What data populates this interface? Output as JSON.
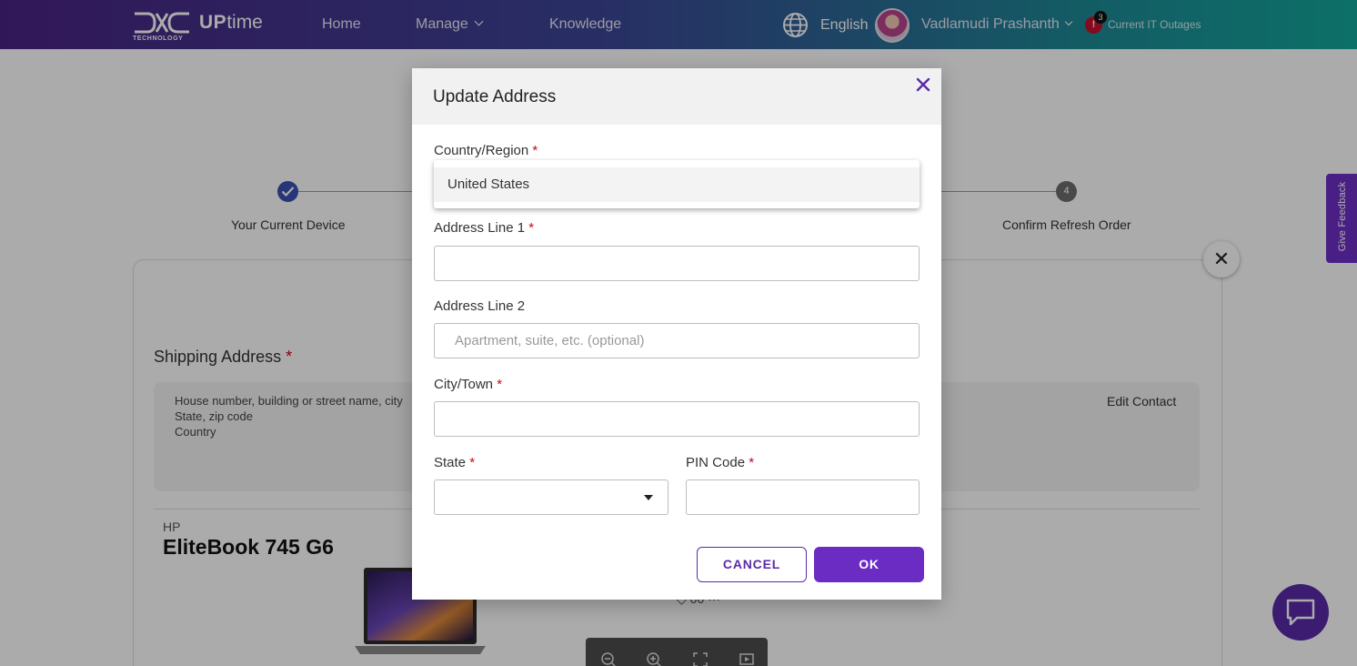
{
  "header": {
    "logo_sub": "TECHNOLOGY",
    "brand_up": "UP",
    "brand_time": "time",
    "nav": {
      "home": "Home",
      "manage": "Manage",
      "knowledge": "Knowledge"
    },
    "language": "English",
    "user_name": "Vadlamudi Prashanth",
    "alert_symbol": "!",
    "alert_count": "3",
    "outages_label": "Current IT Outages"
  },
  "steps": {
    "step1_label": "Your Current Device",
    "step4_number": "4",
    "step4_label": "Confirm Refresh Order"
  },
  "shipping": {
    "title": "Shipping Address",
    "required_mark": "*",
    "address_lines": [
      "House number, building or street name, city",
      "State, zip code",
      "Country"
    ],
    "edit_contact": "Edit Contact"
  },
  "device": {
    "brand": "HP",
    "model": "EliteBook 745 G6",
    "storage_partial": "◇ 00 ···"
  },
  "side": {
    "feedback_label": "Give Feedback",
    "close_symbol": "✕"
  },
  "modal": {
    "title": "Update Address",
    "country_label": "Country/Region",
    "country_option": "United States",
    "address1_label": "Address Line 1",
    "address1_value": "",
    "address2_label": "Address Line 2",
    "address2_placeholder": "Apartment, suite, etc. (optional)",
    "city_label": "City/Town",
    "city_value": "",
    "state_label": "State",
    "state_value": "",
    "pin_label": "PIN Code",
    "pin_value": "",
    "required_mark": "*",
    "cancel_label": "CANCEL",
    "ok_label": "OK"
  },
  "icons": {
    "globe": "globe-icon",
    "chat": "chat-icon",
    "zoom_out": "zoom-out-icon",
    "zoom_in": "zoom-in-icon",
    "fullscreen": "fullscreen-icon",
    "slideshow": "slideshow-icon"
  },
  "colors": {
    "accent_purple": "#6a2cc2",
    "step_done_blue": "#3b4fb5",
    "required_red": "#d0021b",
    "alert_red": "#c8102e"
  }
}
